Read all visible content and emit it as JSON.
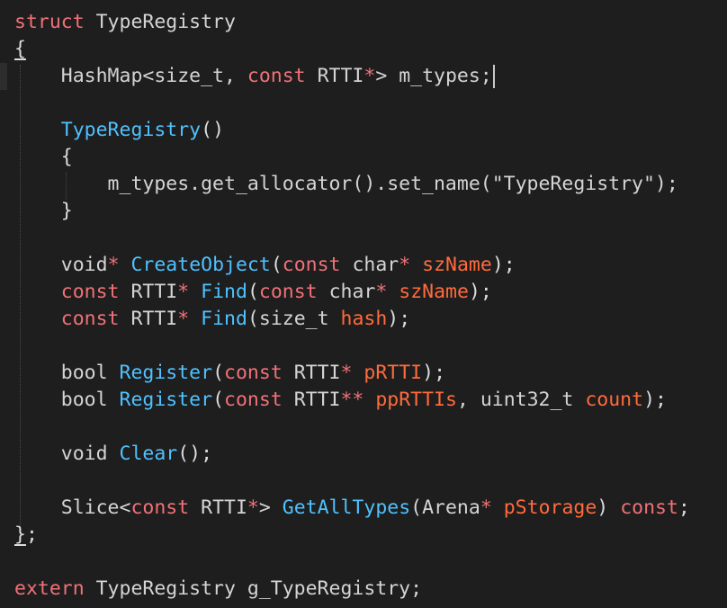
{
  "colors": {
    "background": "#1e1e1e",
    "keyword": "#f07178",
    "type": "#d4d4d4",
    "function": "#4fc1ff",
    "param": "#ff6b3d",
    "punct": "#dcdcdc",
    "string": "#d4d4d4"
  },
  "code": {
    "lines": [
      [
        {
          "t": "struct",
          "c": "kw"
        },
        {
          "t": " TypeRegistry",
          "c": "ty"
        }
      ],
      [
        {
          "t": "{",
          "c": "pu",
          "u": true
        }
      ],
      [
        {
          "t": "    HashMap<size_t, ",
          "c": "ty"
        },
        {
          "t": "const",
          "c": "kw"
        },
        {
          "t": " RTTI",
          "c": "ty"
        },
        {
          "t": "*",
          "c": "kw"
        },
        {
          "t": "> m_types;",
          "c": "ty"
        },
        {
          "t": "",
          "c": "cursor"
        }
      ],
      [],
      [
        {
          "t": "    ",
          "c": "ty"
        },
        {
          "t": "TypeRegistry",
          "c": "fn"
        },
        {
          "t": "()",
          "c": "pu"
        }
      ],
      [
        {
          "t": "    {",
          "c": "pu"
        }
      ],
      [
        {
          "t": "        m_types.get_allocator().set_name(\"TypeRegistry\");",
          "c": "ty"
        }
      ],
      [
        {
          "t": "    }",
          "c": "pu"
        }
      ],
      [],
      [
        {
          "t": "    void",
          "c": "ty"
        },
        {
          "t": "*",
          "c": "kw"
        },
        {
          "t": " ",
          "c": "ty"
        },
        {
          "t": "CreateObject",
          "c": "fn"
        },
        {
          "t": "(",
          "c": "pu"
        },
        {
          "t": "const",
          "c": "kw"
        },
        {
          "t": " char",
          "c": "ty"
        },
        {
          "t": "*",
          "c": "kw"
        },
        {
          "t": " ",
          "c": "ty"
        },
        {
          "t": "szName",
          "c": "pa"
        },
        {
          "t": ");",
          "c": "pu"
        }
      ],
      [
        {
          "t": "    ",
          "c": "ty"
        },
        {
          "t": "const",
          "c": "kw"
        },
        {
          "t": " RTTI",
          "c": "ty"
        },
        {
          "t": "*",
          "c": "kw"
        },
        {
          "t": " ",
          "c": "ty"
        },
        {
          "t": "Find",
          "c": "fn"
        },
        {
          "t": "(",
          "c": "pu"
        },
        {
          "t": "const",
          "c": "kw"
        },
        {
          "t": " char",
          "c": "ty"
        },
        {
          "t": "*",
          "c": "kw"
        },
        {
          "t": " ",
          "c": "ty"
        },
        {
          "t": "szName",
          "c": "pa"
        },
        {
          "t": ");",
          "c": "pu"
        }
      ],
      [
        {
          "t": "    ",
          "c": "ty"
        },
        {
          "t": "const",
          "c": "kw"
        },
        {
          "t": " RTTI",
          "c": "ty"
        },
        {
          "t": "*",
          "c": "kw"
        },
        {
          "t": " ",
          "c": "ty"
        },
        {
          "t": "Find",
          "c": "fn"
        },
        {
          "t": "(size_t ",
          "c": "ty"
        },
        {
          "t": "hash",
          "c": "pa"
        },
        {
          "t": ");",
          "c": "pu"
        }
      ],
      [],
      [
        {
          "t": "    bool ",
          "c": "ty"
        },
        {
          "t": "Register",
          "c": "fn"
        },
        {
          "t": "(",
          "c": "pu"
        },
        {
          "t": "const",
          "c": "kw"
        },
        {
          "t": " RTTI",
          "c": "ty"
        },
        {
          "t": "*",
          "c": "kw"
        },
        {
          "t": " ",
          "c": "ty"
        },
        {
          "t": "pRTTI",
          "c": "pa"
        },
        {
          "t": ");",
          "c": "pu"
        }
      ],
      [
        {
          "t": "    bool ",
          "c": "ty"
        },
        {
          "t": "Register",
          "c": "fn"
        },
        {
          "t": "(",
          "c": "pu"
        },
        {
          "t": "const",
          "c": "kw"
        },
        {
          "t": " RTTI",
          "c": "ty"
        },
        {
          "t": "**",
          "c": "kw"
        },
        {
          "t": " ",
          "c": "ty"
        },
        {
          "t": "ppRTTIs",
          "c": "pa"
        },
        {
          "t": ", uint32_t ",
          "c": "ty"
        },
        {
          "t": "count",
          "c": "pa"
        },
        {
          "t": ");",
          "c": "pu"
        }
      ],
      [],
      [
        {
          "t": "    void ",
          "c": "ty"
        },
        {
          "t": "Clear",
          "c": "fn"
        },
        {
          "t": "();",
          "c": "pu"
        }
      ],
      [],
      [
        {
          "t": "    Slice<",
          "c": "ty"
        },
        {
          "t": "const",
          "c": "kw"
        },
        {
          "t": " RTTI",
          "c": "ty"
        },
        {
          "t": "*",
          "c": "kw"
        },
        {
          "t": "> ",
          "c": "ty"
        },
        {
          "t": "GetAllTypes",
          "c": "fn"
        },
        {
          "t": "(Arena",
          "c": "ty"
        },
        {
          "t": "*",
          "c": "kw"
        },
        {
          "t": " ",
          "c": "ty"
        },
        {
          "t": "pStorage",
          "c": "pa"
        },
        {
          "t": ") ",
          "c": "pu"
        },
        {
          "t": "const",
          "c": "kw"
        },
        {
          "t": ";",
          "c": "pu"
        }
      ],
      [
        {
          "t": "}",
          "c": "pu",
          "u": true
        },
        {
          "t": ";",
          "c": "pu"
        }
      ],
      [],
      [
        {
          "t": "extern",
          "c": "kw"
        },
        {
          "t": " TypeRegistry g_TypeRegistry;",
          "c": "ty"
        }
      ]
    ]
  }
}
